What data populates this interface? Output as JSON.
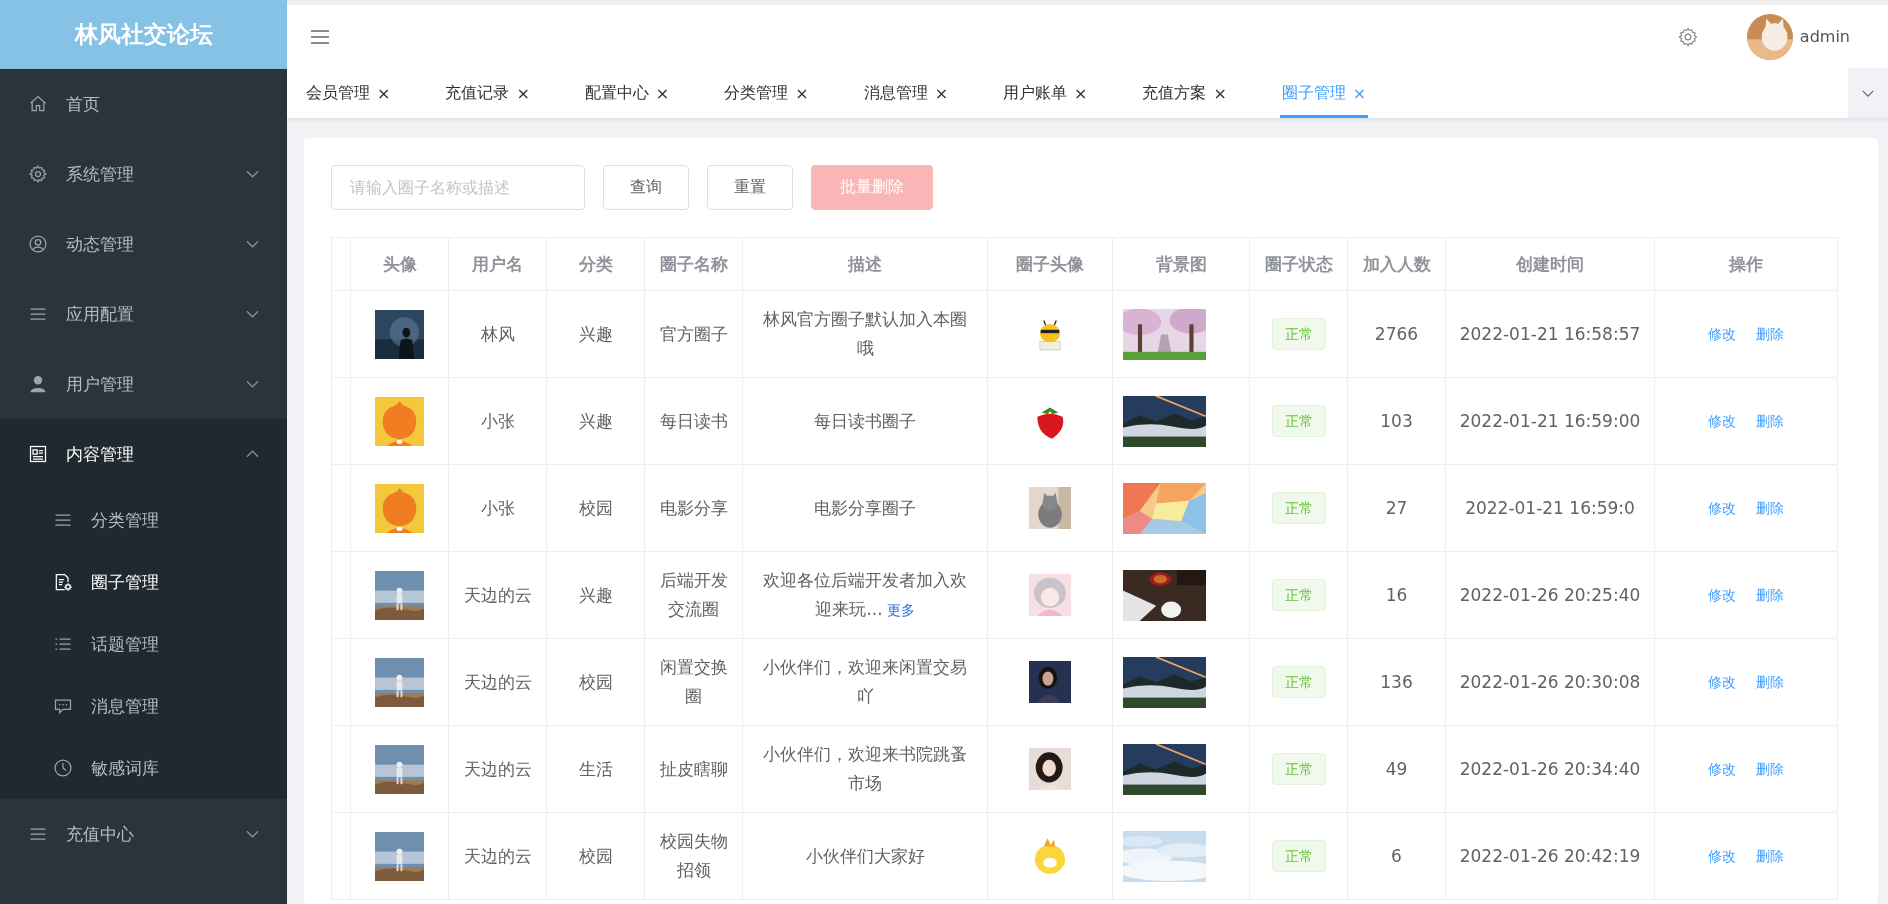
{
  "sidebar": {
    "logo": "林风社交论坛",
    "items": [
      {
        "label": "首页",
        "selected": false
      },
      {
        "label": "系统管理",
        "expanded": false,
        "selected": false
      },
      {
        "label": "动态管理",
        "expanded": false,
        "selected": false
      },
      {
        "label": "应用配置",
        "expanded": false,
        "selected": false
      },
      {
        "label": "用户管理",
        "expanded": false,
        "selected": false
      },
      {
        "label": "内容管理",
        "expanded": true,
        "selected": true,
        "children": [
          {
            "label": "分类管理",
            "selected": false
          },
          {
            "label": "圈子管理",
            "selected": true
          },
          {
            "label": "话题管理",
            "selected": false
          },
          {
            "label": "消息管理",
            "selected": false
          },
          {
            "label": "敏感词库",
            "selected": false
          }
        ]
      },
      {
        "label": "充值中心",
        "expanded": false,
        "selected": false
      }
    ]
  },
  "header": {
    "user": "admin"
  },
  "tabs": [
    {
      "label": "会员管理",
      "close": "×",
      "selected": false
    },
    {
      "label": "充值记录",
      "close": "×",
      "selected": false
    },
    {
      "label": "配置中心",
      "close": "×",
      "selected": false
    },
    {
      "label": "分类管理",
      "close": "×",
      "selected": false
    },
    {
      "label": "消息管理",
      "close": "×",
      "selected": false
    },
    {
      "label": "用户账单",
      "close": "×",
      "selected": false
    },
    {
      "label": "充值方案",
      "close": "×",
      "selected": false
    },
    {
      "label": "圈子管理",
      "close": "×",
      "selected": true
    }
  ],
  "search": {
    "placeholder": "请输入圈子名称或描述"
  },
  "buttons": [
    {
      "label": "查询",
      "kind": "plain",
      "disabled": false
    },
    {
      "label": "重置",
      "kind": "plain",
      "disabled": false
    },
    {
      "label": "批量删除",
      "kind": "danger",
      "disabled": true
    }
  ],
  "table": {
    "columns": [
      "头像",
      "用户名",
      "分类",
      "圈子名称",
      "描述",
      "圈子头像",
      "背景图",
      "圈子状态",
      "加入人数",
      "创建时间",
      "操作"
    ],
    "rows": [
      {
        "user": "林风",
        "category": "兴趣",
        "name": "官方圈子",
        "description": "林风官方圈子默认加入本圈哦",
        "status": "正常",
        "members": "2766",
        "created": "2022-01-21 16:58:57",
        "actions": [
          "修改",
          "删除"
        ]
      },
      {
        "user": "小张",
        "category": "兴趣",
        "name": "每日读书",
        "description": "每日读书圈子",
        "status": "正常",
        "members": "103",
        "created": "2022-01-21 16:59:00",
        "actions": [
          "修改",
          "删除"
        ]
      },
      {
        "user": "小张",
        "category": "校园",
        "name": "电影分享",
        "description": "电影分享圈子",
        "status": "正常",
        "members": "27",
        "created": "2022-01-21 16:59:0",
        "actions": [
          "修改",
          "删除"
        ]
      },
      {
        "user": "天边的云",
        "category": "兴趣",
        "name": "后端开发交流圈",
        "description": "欢迎各位后端开发者加入欢迎来玩...",
        "more": "更多",
        "status": "正常",
        "members": "16",
        "created": "2022-01-26 20:25:40",
        "actions": [
          "修改",
          "删除"
        ]
      },
      {
        "user": "天边的云",
        "category": "校园",
        "name": "闲置交换圈",
        "description": "小伙伴们，欢迎来闲置交易吖",
        "status": "正常",
        "members": "136",
        "created": "2022-01-26 20:30:08",
        "actions": [
          "修改",
          "删除"
        ]
      },
      {
        "user": "天边的云",
        "category": "生活",
        "name": "扯皮瞎聊",
        "description": "小伙伴们，欢迎来书院跳蚤市场",
        "status": "正常",
        "members": "49",
        "created": "2022-01-26 20:34:40",
        "actions": [
          "修改",
          "删除"
        ]
      },
      {
        "user": "天边的云",
        "category": "校园",
        "name": "校园失物招领",
        "description": "小伙伴们大家好",
        "status": "正常",
        "members": "6",
        "created": "2022-01-26 20:42:19",
        "actions": [
          "修改",
          "删除"
        ]
      }
    ]
  }
}
